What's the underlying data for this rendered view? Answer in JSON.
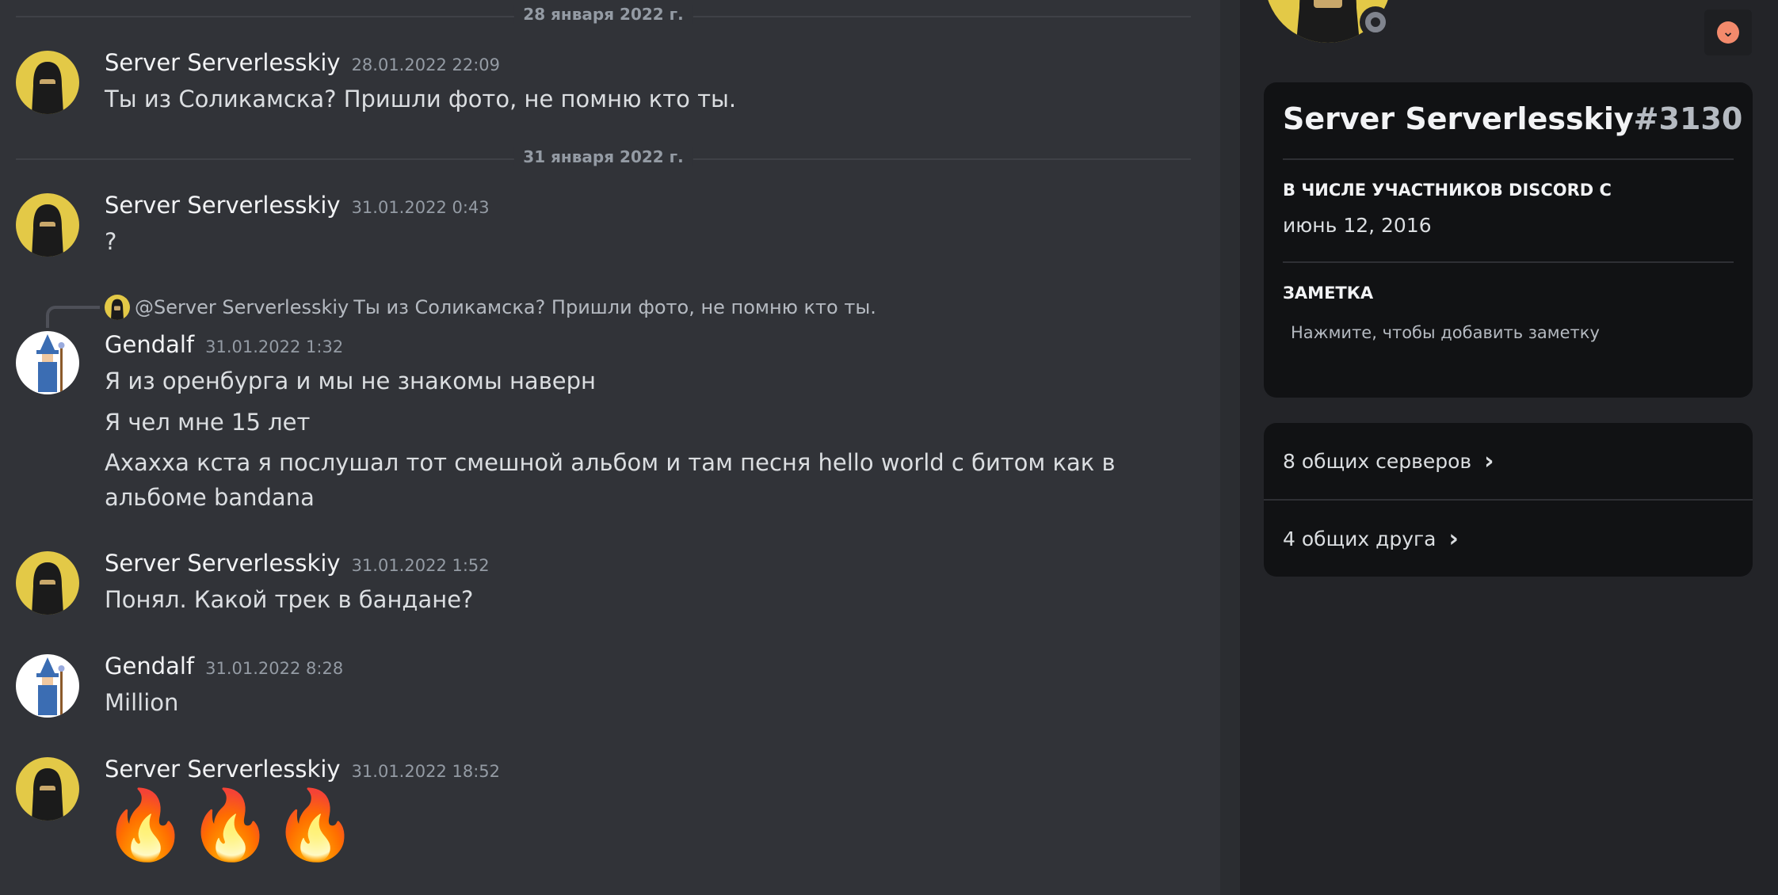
{
  "dividers": {
    "d1": "28 января 2022 г.",
    "d2": "31 января 2022 г."
  },
  "messages": [
    {
      "author": "Server Serverlesskiy",
      "time": "28.01.2022 22:09",
      "lines": [
        "Ты из Соликамска? Пришли фото, не помню кто ты."
      ]
    },
    {
      "author": "Server Serverlesskiy",
      "time": "31.01.2022 0:43",
      "lines": [
        "?"
      ]
    },
    {
      "author": "Gendalf",
      "time": "31.01.2022 1:32",
      "lines": [
        "Я из оренбурга и мы не знакомы наверн",
        "Я чел мне 15 лет",
        "Ахахха кста я послушал тот смешной альбом и там песня hello world с битом как в альбоме bandana"
      ]
    },
    {
      "author": "Server Serverlesskiy",
      "time": "31.01.2022 1:52",
      "lines": [
        "Понял. Какой трек в бандане?"
      ]
    },
    {
      "author": "Gendalf",
      "time": "31.01.2022 8:28",
      "lines": [
        "Million"
      ]
    },
    {
      "author": "Server Serverlesskiy",
      "time": "31.01.2022 18:52",
      "lines": [
        "🔥🔥🔥"
      ]
    }
  ],
  "reply": {
    "mention": "@Server Serverlesskiy",
    "text": "Ты из Соликамска? Пришли фото, не помню кто ты."
  },
  "profile": {
    "name": "Server Serverlesskiy",
    "tag": "#3130",
    "member_since_title": "В ЧИСЛЕ УЧАСТНИКОВ DISCORD С",
    "member_since": "июнь 12, 2016",
    "note_title": "ЗАМЕТКА",
    "note_placeholder": "Нажмите, чтобы добавить заметку",
    "mutual_servers": "8 общих серверов",
    "mutual_friends": "4 общих друга"
  },
  "icons": {
    "chevron": "chevron-right-icon",
    "status": "status-offline-icon",
    "collapse": "chevron-down-icon"
  },
  "colors": {
    "chat_bg": "#313338",
    "panel_bg": "#232428",
    "card_bg": "#111214",
    "accent": "#f38a6c"
  }
}
